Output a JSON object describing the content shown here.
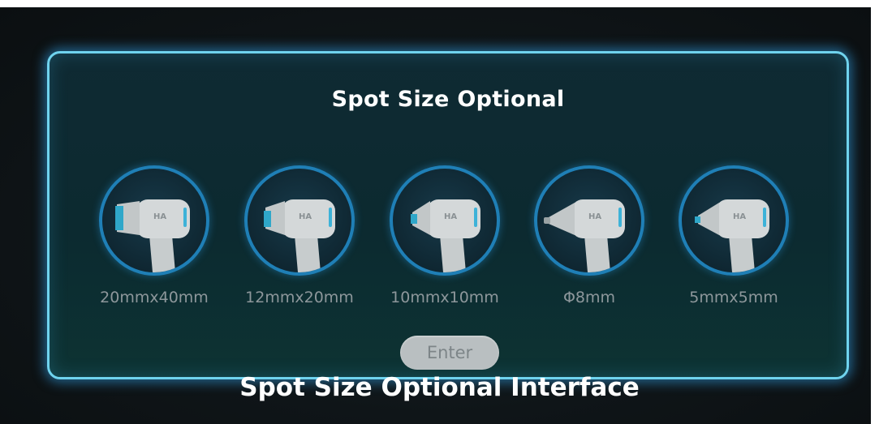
{
  "panel": {
    "title": "Spot Size Optional"
  },
  "options": [
    {
      "label": "20mmx40mm",
      "icon": "handpiece-20x40-icon"
    },
    {
      "label": "12mmx20mm",
      "icon": "handpiece-12x20-icon"
    },
    {
      "label": "10mmx10mm",
      "icon": "handpiece-10x10-icon"
    },
    {
      "label": "Φ8mm",
      "icon": "handpiece-8mm-round-icon"
    },
    {
      "label": "5mmx5mm",
      "icon": "handpiece-5x5-icon"
    }
  ],
  "handpiece_brand": "HA",
  "enter_button": {
    "label": "Enter"
  },
  "caption": "Spot Size Optional Interface",
  "colors": {
    "panel_border": "#6fd3ee",
    "circle_border": "#1f7fb6",
    "button_bg": "#b9bfc1",
    "label_text": "#8d979b"
  }
}
